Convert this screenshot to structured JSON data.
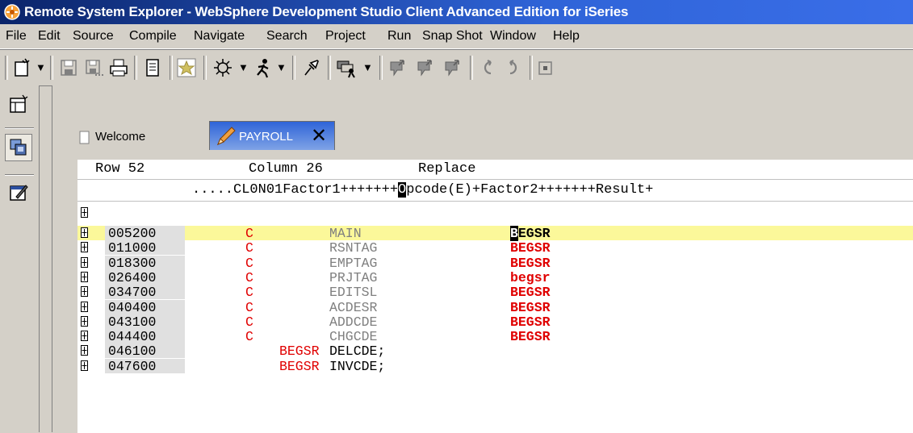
{
  "window": {
    "title": "Remote System Explorer - WebSphere Development Studio Client Advanced Edition for iSeries"
  },
  "menu": [
    "File",
    "Edit",
    "Source",
    "Compile",
    "Navigate",
    "Search",
    "Project",
    "Run",
    "Snap Shot",
    "Window",
    "Help"
  ],
  "tabs": {
    "welcome": "Welcome",
    "payroll": "PAYROLL",
    "close_glyph": "✕"
  },
  "status": {
    "row": "Row 52",
    "column": "Column 26",
    "mode": "Replace"
  },
  "ruler": {
    "prefix": ".....CL0N01Factor1+++++++",
    "cursor_char": "O",
    "suffix": "pcode(E)+Factor2+++++++Result+"
  },
  "code": {
    "empty_line_marker": "⊞",
    "lines": [
      {
        "seq": "005200",
        "type": "C",
        "factor1": "MAIN",
        "opcode_first": "B",
        "opcode_rest": "EGSR"
      },
      {
        "seq": "011000",
        "type": "C",
        "factor1": "RSNTAG",
        "opcode": "BEGSR"
      },
      {
        "seq": "018300",
        "type": "C",
        "factor1": "EMPTAG",
        "opcode": "BEGSR"
      },
      {
        "seq": "026400",
        "type": "C",
        "factor1": "PRJTAG",
        "opcode": "begsr"
      },
      {
        "seq": "034700",
        "type": "C",
        "factor1": "EDITSL",
        "opcode": "BEGSR"
      },
      {
        "seq": "040400",
        "type": "C",
        "factor1": "ACDESR",
        "opcode": "BEGSR"
      },
      {
        "seq": "043100",
        "type": "C",
        "factor1": "ADDCDE",
        "opcode": "BEGSR"
      },
      {
        "seq": "044400",
        "type": "C",
        "factor1": "CHGCDE",
        "opcode": "BEGSR"
      },
      {
        "seq": "046100",
        "keyword": "BEGSR",
        "name": "DELCDE;"
      },
      {
        "seq": "047600",
        "keyword": "BEGSR",
        "name": "INVCDE;"
      }
    ]
  },
  "icons": {
    "titlebar": "rse-app-icon",
    "toolbar": [
      "new-wizard-icon",
      "save-icon",
      "save-all-icon",
      "print-icon",
      "open-file-icon",
      "bookmark-icon",
      "debug-icon",
      "run-icon",
      "pin-icon",
      "remote-connect-icon",
      "step-into-icon",
      "step-over-icon",
      "step-return-icon",
      "back-icon",
      "forward-icon",
      "stop-icon"
    ],
    "leftbar": [
      "open-perspective-icon",
      "remote-systems-perspective-icon",
      "lpex-editor-perspective-icon"
    ]
  },
  "colors": {
    "title_gradient_start": "#0a246a",
    "title_gradient_end": "#3a6ee8",
    "current_line": "#fbf89a",
    "keyword_red": "#e00000",
    "factor_grey": "#808080"
  }
}
